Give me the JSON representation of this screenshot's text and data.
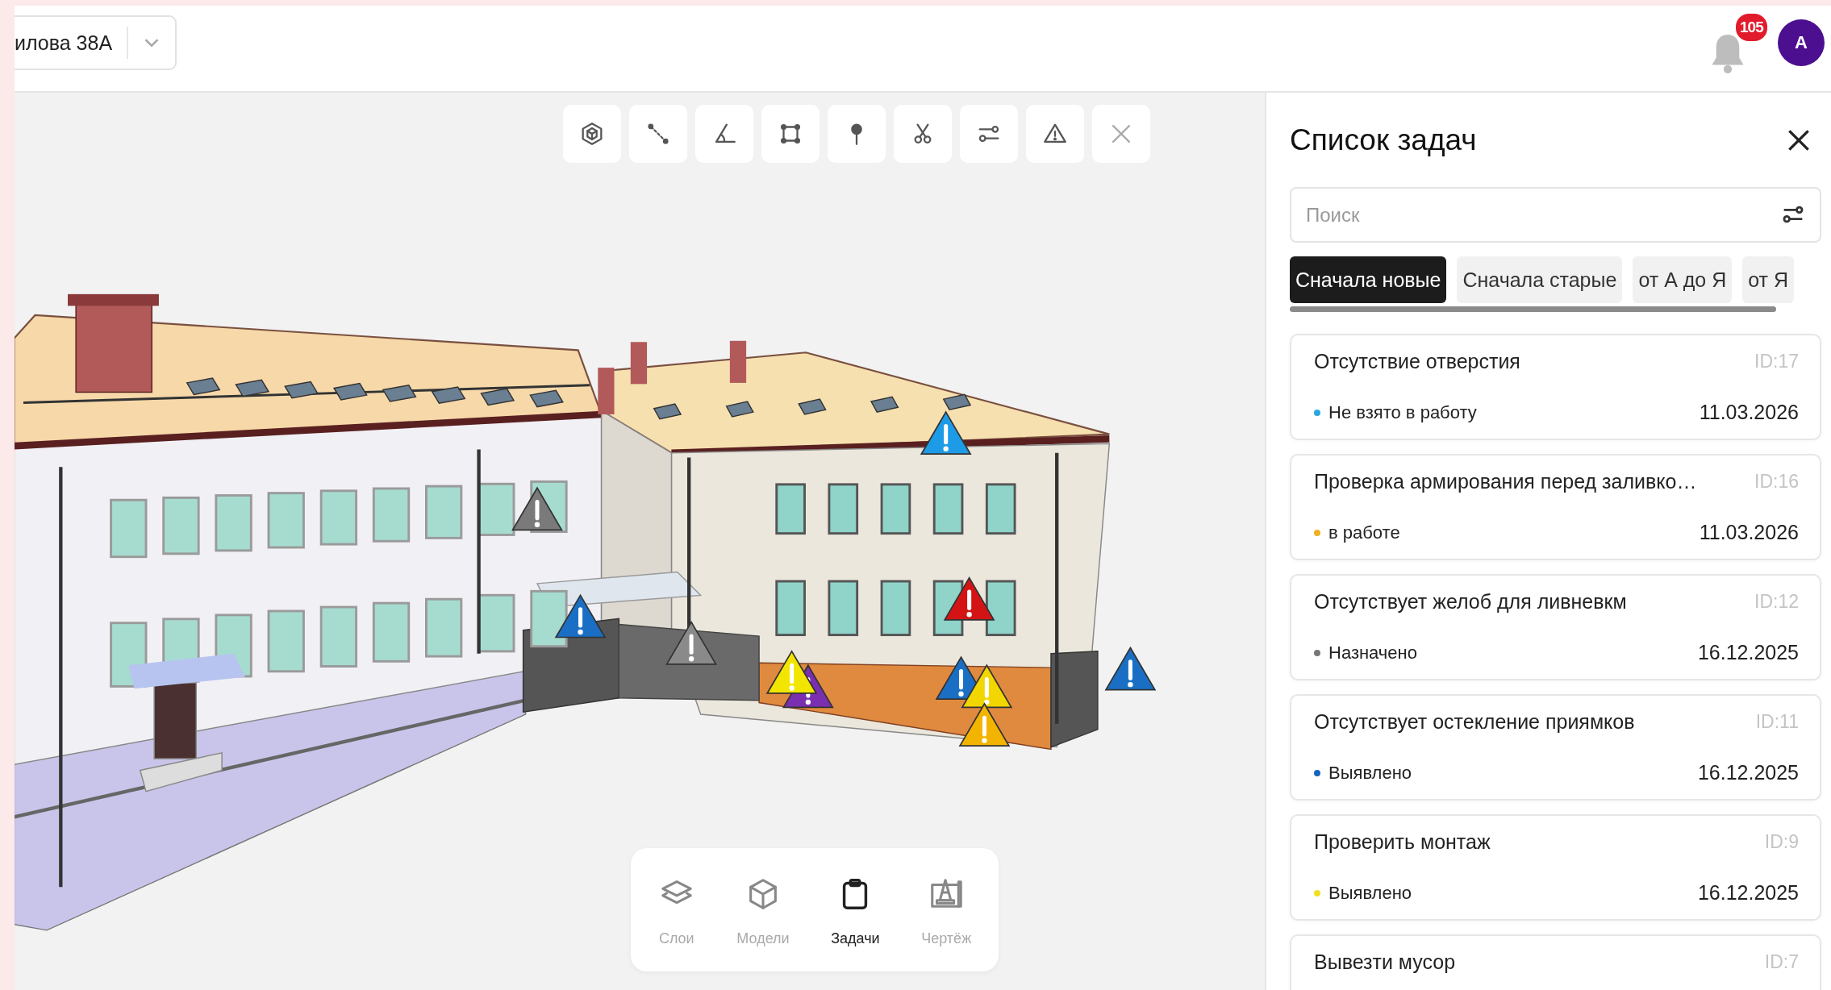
{
  "header": {
    "project_select": {
      "value": "илова 38А"
    },
    "notifications": {
      "badge": "105"
    },
    "avatar": {
      "initial": "А"
    }
  },
  "viewer": {
    "markers": [
      {
        "color": "#1e9be6"
      },
      {
        "color": "#7a7a7a"
      },
      {
        "color": "#1a6fc4"
      },
      {
        "color": "#d41414"
      },
      {
        "color": "#8a8a8a"
      },
      {
        "color": "#7a2fb0"
      },
      {
        "color": "#f2e600"
      },
      {
        "color": "#1a6fc4"
      },
      {
        "color": "#f2d600"
      },
      {
        "color": "#f2b400"
      },
      {
        "color": "#1a6fc4"
      }
    ],
    "dock": [
      {
        "label": "Слои",
        "selected": false
      },
      {
        "label": "Модели",
        "selected": false
      },
      {
        "label": "Задачи",
        "selected": true
      },
      {
        "label": "Чертёж",
        "selected": false
      }
    ]
  },
  "task_panel": {
    "title": "Список задач",
    "search": {
      "placeholder": "Поиск"
    },
    "sort_tabs": [
      {
        "label": "Сначала новые",
        "selected": true
      },
      {
        "label": "Сначала старые",
        "selected": false
      },
      {
        "label": "от А до Я",
        "selected": false
      },
      {
        "label": "от Я",
        "selected": false
      }
    ],
    "tasks": [
      {
        "title": "Отсутствие отверстия",
        "id": "ID:17",
        "status": "Не взято в работу",
        "color": "#29a8e0",
        "date": "11.03.2026"
      },
      {
        "title": "Проверка армирования перед заливко…",
        "id": "ID:16",
        "status": "в работе",
        "color": "#f0b020",
        "date": "11.03.2026"
      },
      {
        "title": "Отсутствует желоб для ливневкм",
        "id": "ID:12",
        "status": "Назначено",
        "color": "#777777",
        "date": "16.12.2025"
      },
      {
        "title": "Отсутствует остекление приямков",
        "id": "ID:11",
        "status": "Выявлено",
        "color": "#1565c0",
        "date": "16.12.2025"
      },
      {
        "title": "Проверить монтаж",
        "id": "ID:9",
        "status": "Выявлено",
        "color": "#f0e020",
        "date": "16.12.2025"
      },
      {
        "title": "Вывезти мусор",
        "id": "ID:7"
      }
    ]
  }
}
